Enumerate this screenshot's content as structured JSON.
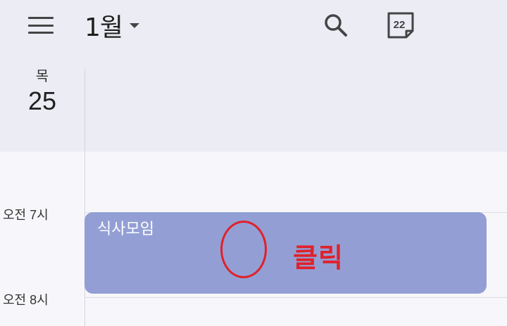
{
  "header": {
    "month_label": "1월",
    "today_icon_text": "22"
  },
  "day": {
    "weekday": "목",
    "date": "25"
  },
  "time_labels": [
    "오전 7시",
    "오전 8시"
  ],
  "event": {
    "title": "식사모임",
    "color": "#939fd4"
  },
  "annotation": {
    "text": "클릭",
    "color": "#e0212a"
  },
  "icons": {
    "menu": "menu-icon",
    "dropdown": "chevron-down-icon",
    "search": "search-icon",
    "today": "calendar-today-icon"
  }
}
